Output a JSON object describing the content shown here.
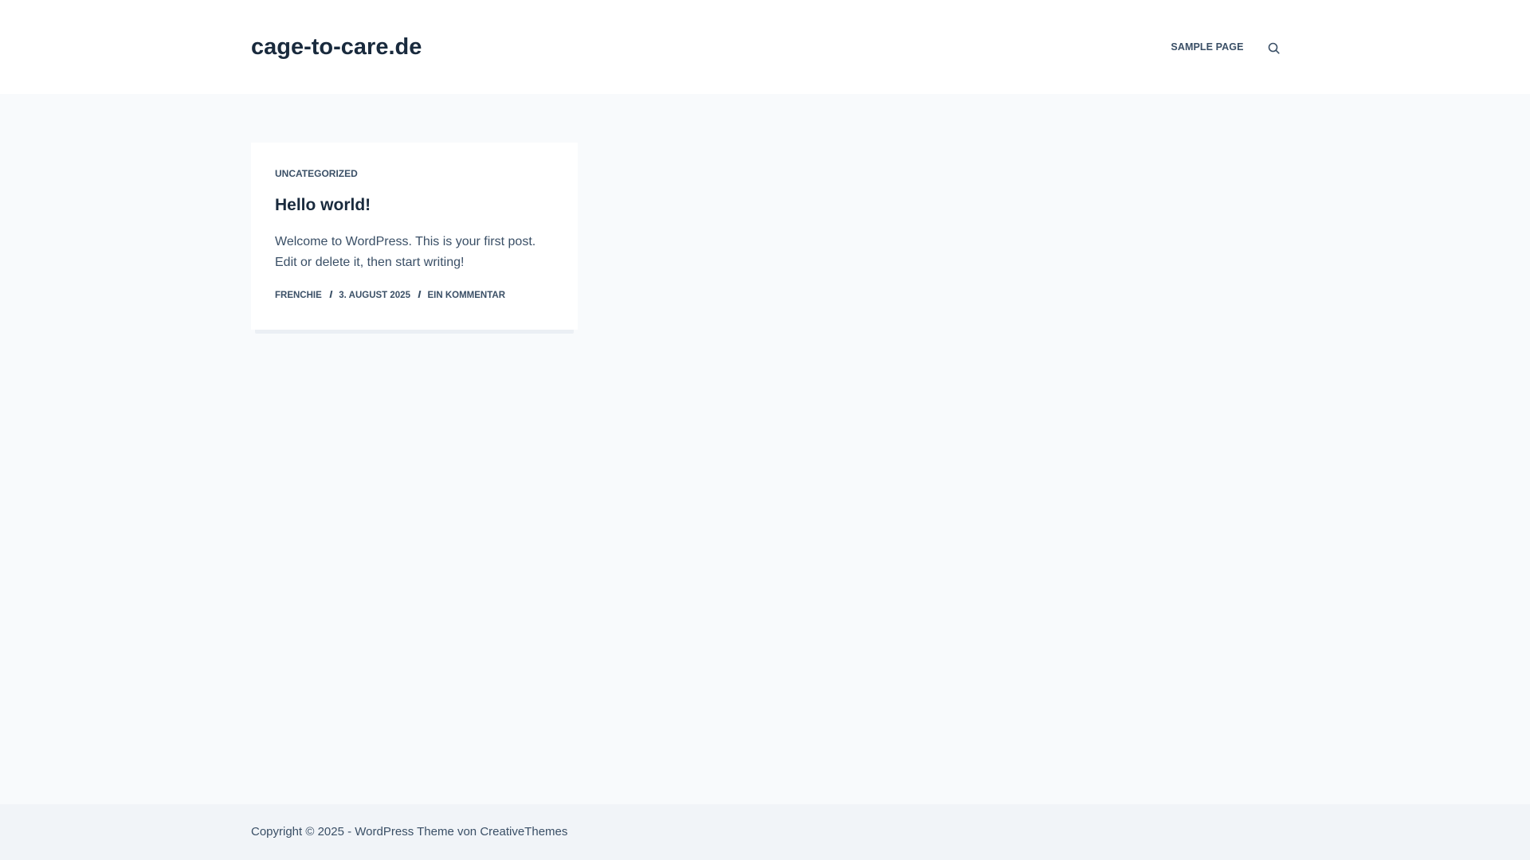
{
  "header": {
    "site_title": "cage-to-care.de",
    "nav": [
      {
        "label": "SAMPLE PAGE"
      }
    ],
    "search_icon": "search-icon"
  },
  "post": {
    "category": "UNCATEGORIZED",
    "title": "Hello world!",
    "excerpt": "Welcome to WordPress. This is your first post. Edit or delete it, then start writing!",
    "meta": {
      "author": "FRENCHIE",
      "date": "3. AUGUST 2025",
      "comments": "EIN KOMMENTAR"
    }
  },
  "footer": {
    "copyright_prefix": "Copyright © 2025 - ",
    "wordpress_theme": "WordPress Theme",
    "von": " von ",
    "creative_themes": "CreativeThemes"
  },
  "colors": {
    "heading": "#192a3d",
    "text": "#3a4f66",
    "background": "#f8fafc",
    "card": "#ffffff",
    "footer": "#f1f4f8"
  }
}
